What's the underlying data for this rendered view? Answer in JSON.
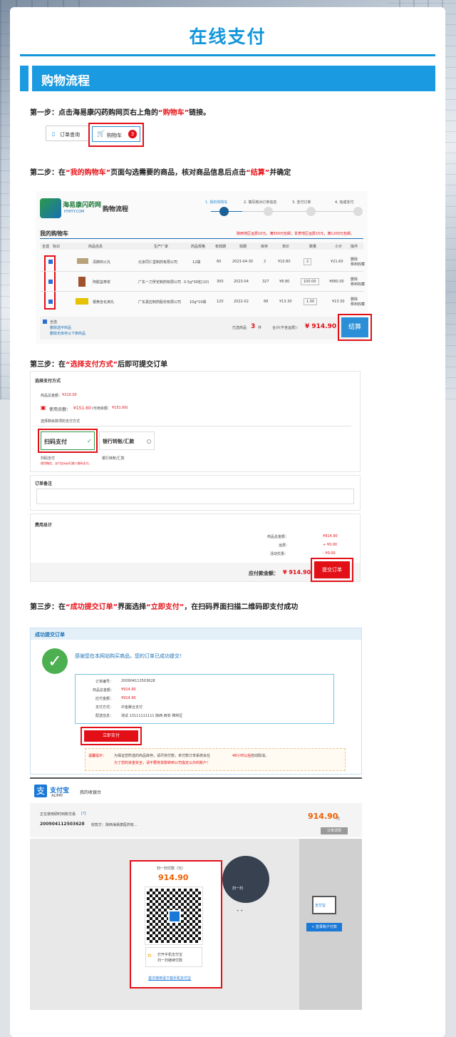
{
  "page": {
    "title": "在线支付",
    "section": "购物流程"
  },
  "step1": {
    "pre": "第一步：点击海易康闪药购网页右上角的",
    "hl": "“购物车”",
    "post": "链接。",
    "order_btn": "订单查询",
    "cart_btn": "购物车",
    "cart_count": "3"
  },
  "step2": {
    "pre": "第二步：在",
    "hl": "“我的购物车”",
    "mid": "页面勾选需要的商品，核对商品信息后点击",
    "hl2": "“结算”",
    "post": "并确定",
    "logo": "海易康闪药网",
    "logo_sub": "HYKYY.COM",
    "heading": "购物流程",
    "progress": [
      "1. 我的购物车",
      "2. 填写核对订单信息",
      "3. 支付订单",
      "4. 完成支付"
    ],
    "cart_title": "我的购物车",
    "notice": "陕西地区运费10元，满500元包邮；甘肃地区运费15元，满1200元包邮。",
    "cols": [
      "全选",
      "标识",
      "商品信息",
      "生产厂家",
      "药品规格",
      "有效期",
      "效期",
      "库存",
      "单价",
      "数量",
      "小计",
      "操作"
    ],
    "rows": [
      {
        "name": "清肺抑火丸",
        "maker": "北京同仁堂制药有限公司",
        "spec": "12袋",
        "num": "60",
        "date": "2023-04-30",
        "stock": "2",
        "price": "¥10.80",
        "qty": "2",
        "sub": "¥21.60",
        "op1": "删除",
        "op2": "移到收藏"
      },
      {
        "name": "阿胶益寿浆",
        "maker": "广东一力罗定制药有限公司",
        "spec": "0.5g*30粒(10)",
        "num": "300",
        "date": "2023-04",
        "stock": "327",
        "price": "¥8.80",
        "qty": "100.00",
        "sub": "¥880.00",
        "op1": "删除",
        "op2": "移到收藏"
      },
      {
        "name": "银黄含化滴丸",
        "maker": "广东嘉应制药股份有限公司",
        "spec": "10g*10袋",
        "num": "120",
        "date": "2022-02",
        "stock": "68",
        "price": "¥13.30",
        "qty": "1.00",
        "sub": "¥13.30",
        "op1": "删除",
        "op2": "移到收藏"
      }
    ],
    "select_all": "全选",
    "del_sel": "删除选中商品",
    "del_invalid": "删除无库存以下架商品",
    "selected_label": "已选商品",
    "selected_count": "3",
    "selected_unit": "件",
    "total_label": "合计(不含运费)：",
    "total": "¥ 914.90",
    "checkout": "结算"
  },
  "step3": {
    "pre": "第三步：在",
    "hl": "“选择支付方式”",
    "post": "后即可提交订单",
    "pm_title": "选择支付方式",
    "goods_total_label": "商品总金额：",
    "goods_total": "¥210.00",
    "balance_label": "使用余额：",
    "balance": "¥151.60",
    "balance_avail": "(可用余额：",
    "balance_avail_val": "¥151.60)",
    "remain": "选择剩余款项的支付方式",
    "opt1": "扫码支付",
    "opt2": "银行转账/汇款",
    "opt1_sub": "扫码支付",
    "opt1_note": "使用微信、支付宝app扫描二维码支付。",
    "opt2_sub": "银行转账/汇款",
    "memo_title": "订单备注",
    "fee_title": "费用总计",
    "fee_goods_label": "商品总金额：",
    "fee_goods": "¥914.90",
    "fee_ship_label": "运费：",
    "fee_ship": "+ ¥0.00",
    "fee_promo_label": "活动优惠：",
    "fee_promo": "- ¥0.00",
    "pay_label": "应付款金额：",
    "pay_amount": "¥ 914.90",
    "submit": "提交订单"
  },
  "step4": {
    "pre": "第三步：在",
    "hl": "“成功提交订单”",
    "mid": "界面选择",
    "hl2": "“立即支付”",
    "post": "，在扫码界面扫描二维码即支付成功",
    "succ_title": "成功提交订单",
    "thanks": "感谢您在本网站购买商品，您的订单已成功提交！",
    "info": [
      [
        "订单编号：",
        "200904112503628"
      ],
      [
        "商品总金额：",
        "¥914.90"
      ],
      [
        "应付金额：",
        "¥914.90"
      ],
      [
        "支付方式：",
        "中金聚合支付"
      ],
      [
        "配送信息：",
        "测试 13111111111 陕西 西安 碑林区"
      ]
    ],
    "pay_now": "立即支付",
    "tip_label": "温馨提示：",
    "tip1": "为保证您所选的商品库存，请尽快付款，未付款订单系统会在",
    "tip1_red": "48小时以后",
    "tip1_end": "自动取消。",
    "tip2": "为了您的资金安全，请不要将货款转到公司指定以外的账户！"
  },
  "alipay": {
    "logo": "支付宝",
    "logo_sub": "ALIPAY",
    "cashier": "我的收银台",
    "using": "正在使用即时到账交易",
    "help": "[?]",
    "amount": "914.90",
    "yuan": "元",
    "order_no": "200904112503628",
    "payee": "收款方：陕西海易康医药有...",
    "detail": "订单详情",
    "scan_title": "扫一扫付款（元）",
    "scan_amount": "914.90",
    "open_app": "打开手机支付宝",
    "scan_go": "扫一扫继续付款",
    "download": "首次使用请下载手机支付宝",
    "phone_label": "扫一扫",
    "login_pay": "< 登录账户付款",
    "pc_label": "支付宝"
  }
}
